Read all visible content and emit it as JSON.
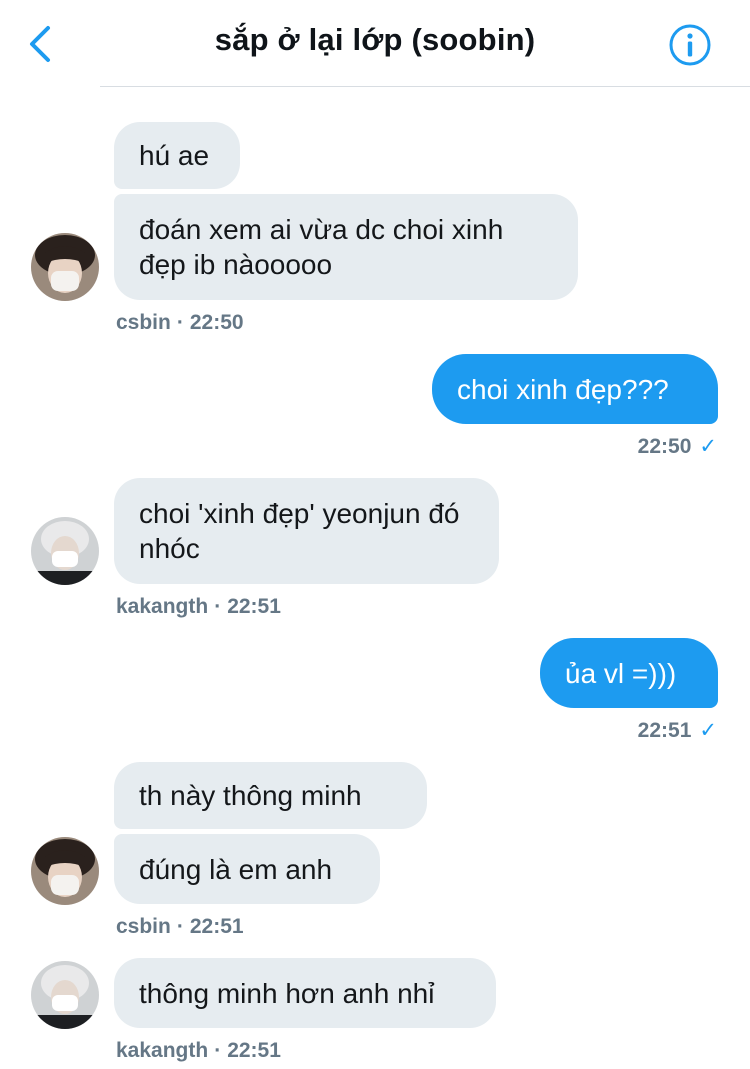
{
  "header": {
    "title": "sắp ở lại lớp (soobin)",
    "accent_color": "#1d9bf0",
    "back_icon": "chevron-left-icon",
    "info_icon": "info-circle-icon"
  },
  "messages": [
    {
      "sender": "csbin",
      "direction": "incoming",
      "text": "hú ae"
    },
    {
      "sender": "csbin",
      "direction": "incoming",
      "text": "đoán xem ai vừa dc choi xinh đẹp ib nàooooo"
    },
    {
      "sender": "me",
      "direction": "outgoing",
      "text": "choi xinh đẹp???"
    },
    {
      "sender": "kakangth",
      "direction": "incoming",
      "text": "choi 'xinh đẹp' yeonjun đó nhóc"
    },
    {
      "sender": "me",
      "direction": "outgoing",
      "text": "ủa vl =)))"
    },
    {
      "sender": "csbin",
      "direction": "incoming",
      "text": "th này thông minh"
    },
    {
      "sender": "csbin",
      "direction": "incoming",
      "text": "đúng là em anh"
    },
    {
      "sender": "kakangth",
      "direction": "incoming",
      "text": "thông minh hơn anh nhỉ"
    }
  ],
  "meta": [
    {
      "name": "csbin",
      "time": "22:50"
    },
    {
      "time": "22:50",
      "status": "✓"
    },
    {
      "name": "kakangth",
      "time": "22:51"
    },
    {
      "time": "22:51",
      "status": "✓"
    },
    {
      "name": "csbin",
      "time": "22:51"
    },
    {
      "name": "kakangth",
      "time": "22:51"
    }
  ],
  "separator": "·",
  "colors": {
    "incoming_bubble": "#e6ecf0",
    "outgoing_bubble": "#1d9bf0",
    "meta_text": "#657786"
  }
}
